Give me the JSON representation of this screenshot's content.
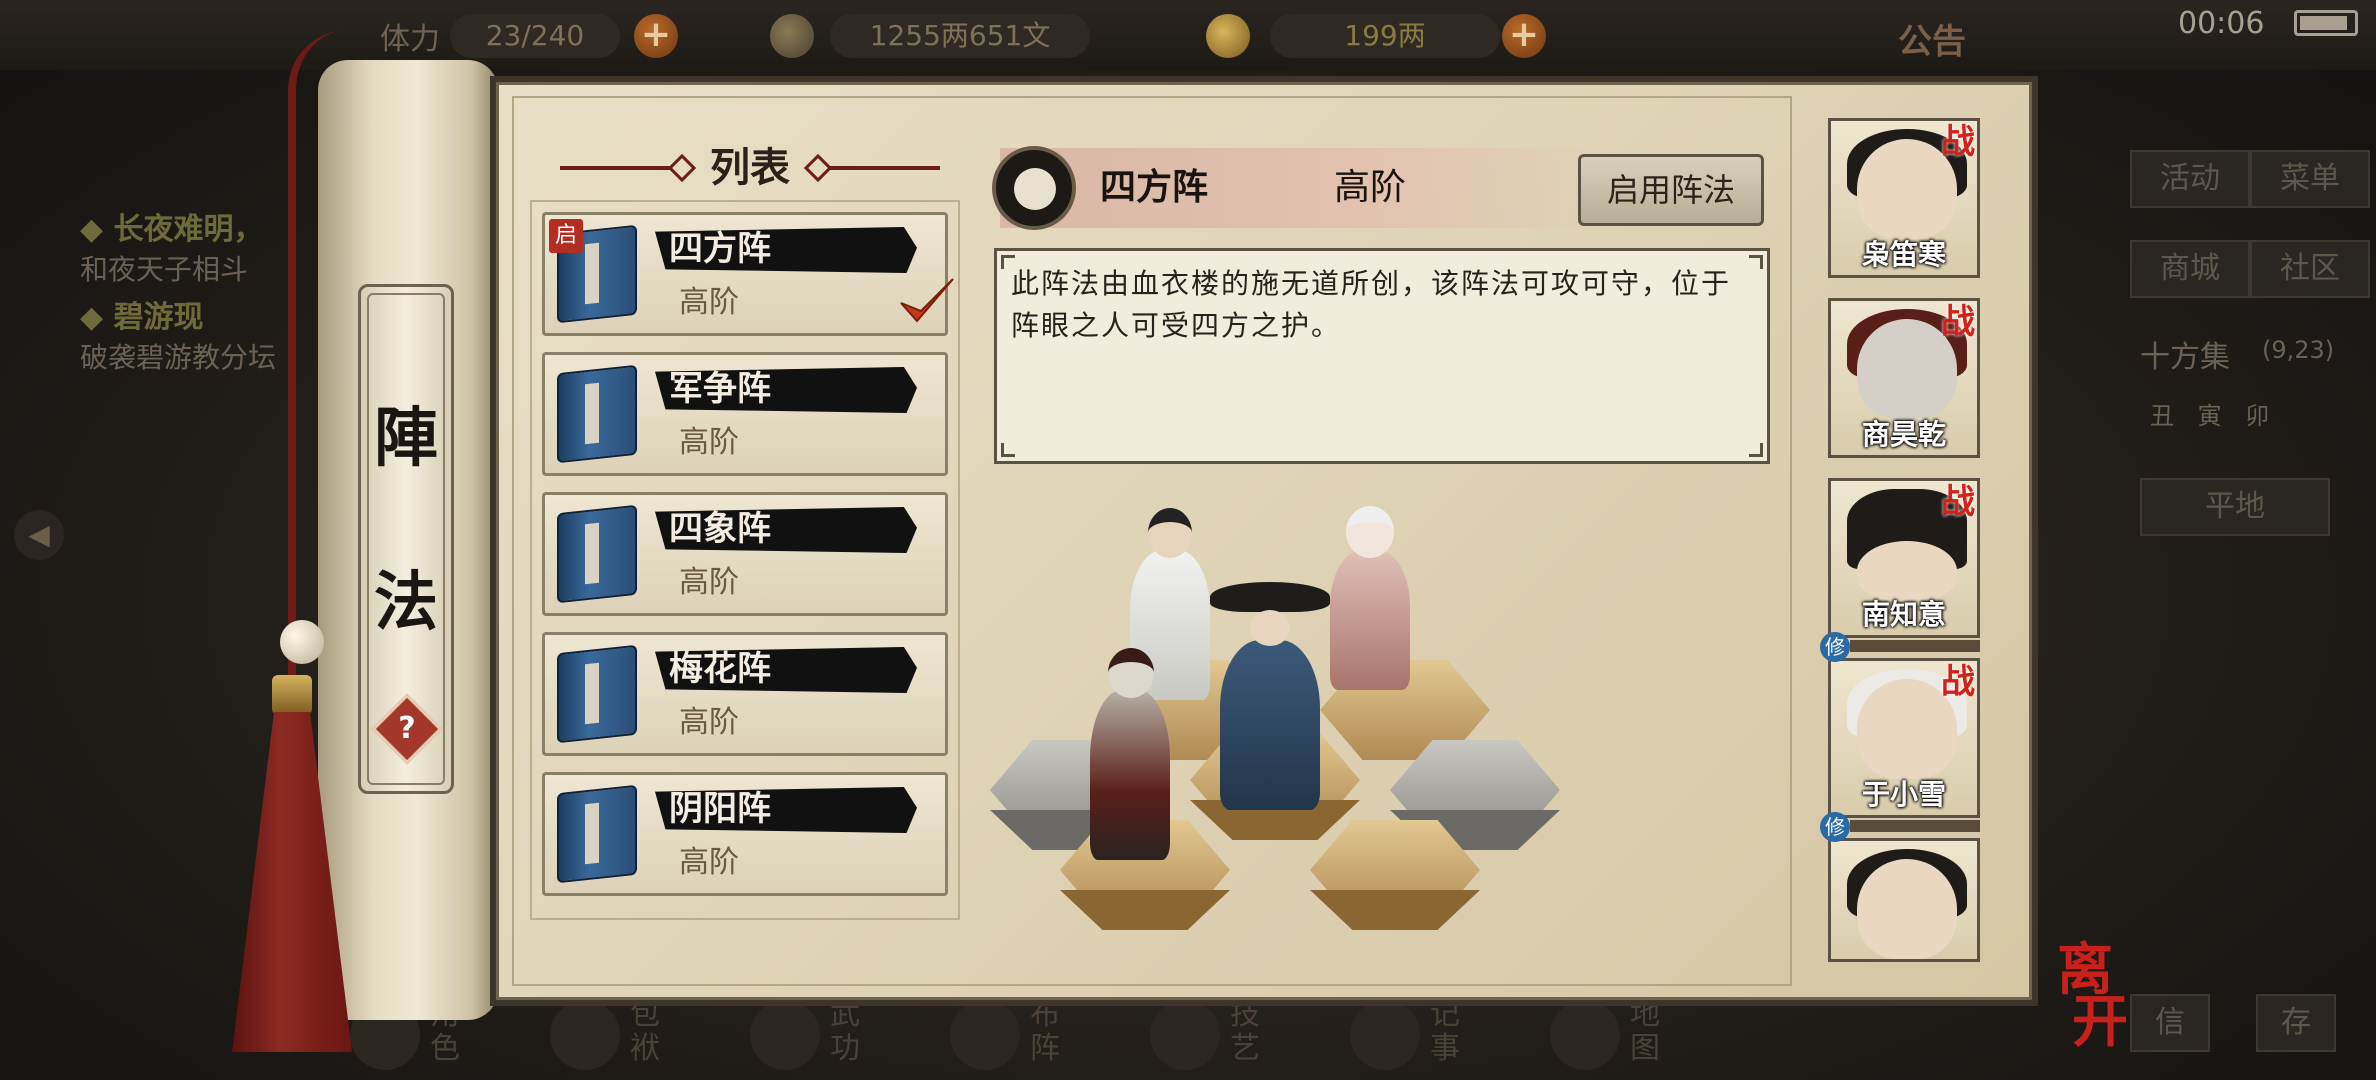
{
  "status_bar": {
    "time": "00:06",
    "battery_level": 0.9
  },
  "top_bar": {
    "stamina_label": "体力",
    "stamina_value": "23/240",
    "money_value": "1255两651文",
    "gold_value": "199两",
    "notice_label": "公告"
  },
  "background": {
    "quest_items": [
      {
        "title": "长夜难明，",
        "desc": "和夜天子相斗"
      },
      {
        "title": "碧游现",
        "desc": "破袭碧游教分坛"
      }
    ],
    "right_buttons": [
      "活动",
      "菜单",
      "商城",
      "社区"
    ],
    "collection_label": "十方集",
    "collection_coords": "(9,23)",
    "time_row": "丑 寅 卯",
    "terrain_label": "平地",
    "bottom_nav": [
      "角色",
      "包袱",
      "武功",
      "布阵",
      "技艺",
      "记事",
      "地图"
    ],
    "corner_buttons": [
      "信",
      "存"
    ]
  },
  "panel": {
    "scroll_title_chars": [
      "陣",
      "法"
    ],
    "help_label": "?",
    "list_title": "列表",
    "formations": [
      {
        "name": "四方阵",
        "rank": "高阶",
        "active_badge": "启",
        "selected": true
      },
      {
        "name": "军争阵",
        "rank": "高阶",
        "active_badge": "",
        "selected": false
      },
      {
        "name": "四象阵",
        "rank": "高阶",
        "active_badge": "",
        "selected": false
      },
      {
        "name": "梅花阵",
        "rank": "高阶",
        "active_badge": "",
        "selected": false
      },
      {
        "name": "阴阳阵",
        "rank": "高阶",
        "active_badge": "",
        "selected": false
      }
    ],
    "detail": {
      "name": "四方阵",
      "rank": "高阶",
      "activate_button": "启用阵法",
      "description": "此阵法由血衣楼的施无道所创，该阵法可攻可守，位于阵眼之人可受四方之护。"
    },
    "roster": [
      {
        "name": "枭笛寒",
        "battle_badge": "战",
        "cultivate_badge": ""
      },
      {
        "name": "商昊乾",
        "battle_badge": "战",
        "cultivate_badge": ""
      },
      {
        "name": "南知意",
        "battle_badge": "战",
        "cultivate_badge": "修"
      },
      {
        "name": "于小雪",
        "battle_badge": "战",
        "cultivate_badge": "修"
      },
      {
        "name": "",
        "battle_badge": "",
        "cultivate_badge": ""
      }
    ],
    "leave_button": "离开"
  },
  "colors": {
    "accent_red": "#c8201a",
    "paper": "#e9dfc7",
    "ink": "#1a1410"
  }
}
